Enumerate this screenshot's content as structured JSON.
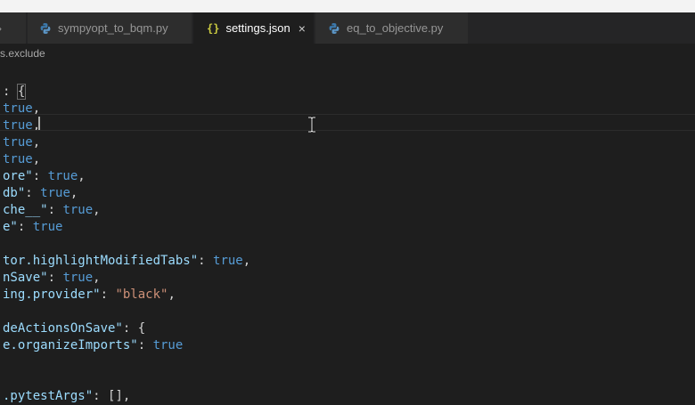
{
  "tabs": [
    {
      "label": "sympyopt_to_bqm.py",
      "icon": "python-icon",
      "active": false
    },
    {
      "label": "settings.json",
      "icon": "json-icon",
      "icon_text": "{}",
      "active": true,
      "close": "×"
    },
    {
      "label": "eq_to_objective.py",
      "icon": "python-icon",
      "active": false
    }
  ],
  "breadcrumb": "s.exclude",
  "colors": {
    "key": "#9cdcfe",
    "boolean": "#569cd6",
    "string": "#ce9178",
    "editor_bg": "#1e1e1e",
    "tab_bar_bg": "#252526"
  },
  "code_lines": [
    [],
    [
      {
        "t": ": ",
        "c": "punc"
      },
      {
        "t": "{",
        "c": "brace"
      }
    ],
    [
      {
        "t": "true",
        "c": "bool"
      },
      {
        "t": ",",
        "c": "punc"
      }
    ],
    [
      {
        "t": "true",
        "c": "bool"
      },
      {
        "t": ",",
        "c": "punc"
      }
    ],
    [
      {
        "t": "true",
        "c": "bool"
      },
      {
        "t": ",",
        "c": "punc"
      }
    ],
    [
      {
        "t": "true",
        "c": "bool"
      },
      {
        "t": ",",
        "c": "punc"
      }
    ],
    [
      {
        "t": "ore\"",
        "c": "key"
      },
      {
        "t": ": ",
        "c": "punc"
      },
      {
        "t": "true",
        "c": "bool"
      },
      {
        "t": ",",
        "c": "punc"
      }
    ],
    [
      {
        "t": "db\"",
        "c": "key"
      },
      {
        "t": ": ",
        "c": "punc"
      },
      {
        "t": "true",
        "c": "bool"
      },
      {
        "t": ",",
        "c": "punc"
      }
    ],
    [
      {
        "t": "che__\"",
        "c": "key"
      },
      {
        "t": ": ",
        "c": "punc"
      },
      {
        "t": "true",
        "c": "bool"
      },
      {
        "t": ",",
        "c": "punc"
      }
    ],
    [
      {
        "t": "e\"",
        "c": "key"
      },
      {
        "t": ": ",
        "c": "punc"
      },
      {
        "t": "true",
        "c": "bool"
      }
    ],
    [],
    [
      {
        "t": "tor.highlightModifiedTabs\"",
        "c": "key"
      },
      {
        "t": ": ",
        "c": "punc"
      },
      {
        "t": "true",
        "c": "bool"
      },
      {
        "t": ",",
        "c": "punc"
      }
    ],
    [
      {
        "t": "nSave\"",
        "c": "key"
      },
      {
        "t": ": ",
        "c": "punc"
      },
      {
        "t": "true",
        "c": "bool"
      },
      {
        "t": ",",
        "c": "punc"
      }
    ],
    [
      {
        "t": "ing.provider\"",
        "c": "key"
      },
      {
        "t": ": ",
        "c": "punc"
      },
      {
        "t": "\"black\"",
        "c": "str"
      },
      {
        "t": ",",
        "c": "punc"
      }
    ],
    [],
    [
      {
        "t": "deActionsOnSave\"",
        "c": "key"
      },
      {
        "t": ": ",
        "c": "punc"
      },
      {
        "t": "{",
        "c": "punc"
      }
    ],
    [
      {
        "t": "e.organizeImports\"",
        "c": "key"
      },
      {
        "t": ": ",
        "c": "punc"
      },
      {
        "t": "true",
        "c": "bool"
      }
    ],
    [],
    [],
    [
      {
        "t": ".pytestArgs\"",
        "c": "key"
      },
      {
        "t": ": ",
        "c": "punc"
      },
      {
        "t": "[],",
        "c": "punc"
      }
    ]
  ]
}
